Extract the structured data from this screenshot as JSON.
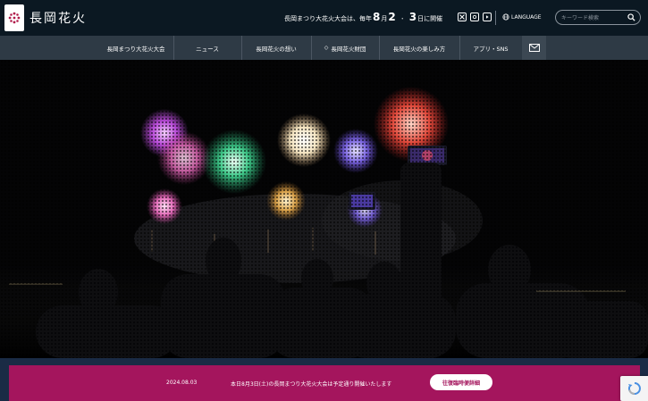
{
  "header": {
    "brand": "長岡花火",
    "announce_prefix": "長岡まつり大花火大会は、毎年",
    "announce_month": "8",
    "announce_month_unit": "月",
    "announce_day1": "2",
    "announce_sep": "・",
    "announce_day2": "3",
    "announce_suffix": "日に開催",
    "language_label": "LANGUAGE",
    "search_placeholder": "キーワード検索"
  },
  "social_icons": [
    "x-icon",
    "instagram-icon",
    "youtube-icon"
  ],
  "nav": {
    "items": [
      {
        "label": "長岡まつり大花火大会"
      },
      {
        "label": "ニュース"
      },
      {
        "label": "長岡花火の想い"
      },
      {
        "label": "長岡花火財団"
      },
      {
        "label": "長岡花火の楽しみ方"
      },
      {
        "label": "アプリ・SNS"
      }
    ]
  },
  "news": {
    "date": "2024.08.03",
    "text": "本日8月3日(土)の長岡まつり大花火大会は予定通り開催いたします",
    "button_label": "往復臨時便詳細"
  },
  "colors": {
    "header_bg": "#0b1822",
    "nav_bg": "#2e3a45",
    "news_bg": "#a4155d",
    "band_bg": "#1a2b45"
  }
}
